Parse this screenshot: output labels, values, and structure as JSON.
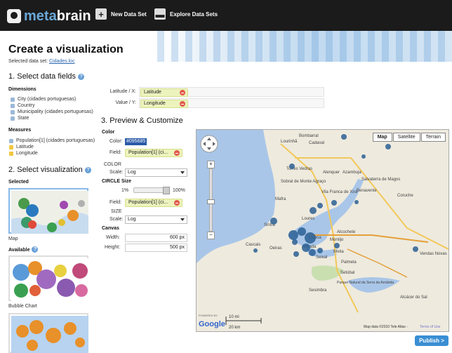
{
  "app": {
    "logo_meta": "meta",
    "logo_brain": "brain",
    "nav": [
      {
        "label": "New Data Set",
        "icon": "plus-icon"
      },
      {
        "label": "Explore Data Sets",
        "icon": "dataset-icon"
      }
    ]
  },
  "page": {
    "title": "Create a visualization",
    "selected_dataset_prefix": "Selected data set:",
    "selected_dataset_link": "Cidades.loc"
  },
  "section1": {
    "title": "1. Select data fields",
    "dimensions_title": "Dimensions",
    "dimensions": [
      "City (cidades portuguesas)",
      "Country",
      "Municipality (cidades portuguesas)",
      "State"
    ],
    "measures_title": "Measures",
    "measures": [
      {
        "label": "Population[1] (cidades portuguesas)",
        "checked": false
      },
      {
        "label": "Latitude",
        "checked": true
      },
      {
        "label": "Longitude",
        "checked": true
      }
    ],
    "x_label": "Latitude / X:",
    "x_value": "Latitude",
    "y_label": "Value / Y:",
    "y_value": "Longitude"
  },
  "section2": {
    "title": "2. Select visualization",
    "selected_title": "Selected",
    "selected_name": "Map",
    "available_title": "Available",
    "available_first": "Bubble Chart"
  },
  "section3": {
    "title": "3. Preview & Customize",
    "color_title": "Color",
    "color_label": "Color:",
    "color_value": "#095685",
    "field_label": "Field:",
    "color_field_value": "Population[1] (ci...",
    "color_scale_group": "COLOR",
    "scale_label": "Scale:",
    "color_scale_value": "Log",
    "circle_title": "CIRCLE Size",
    "slider_min": "1%",
    "slider_max": "100%",
    "size_field_value": "Population[1] (ci...",
    "size_scale_group": "SIZE",
    "size_scale_value": "Log",
    "canvas_title": "Canvas",
    "width_label": "Width:",
    "width_value": "600 px",
    "height_label": "Height:",
    "height_value": "500 px"
  },
  "map": {
    "types": [
      "Map",
      "Satellite",
      "Terrain"
    ],
    "active_type": "Map",
    "cities": [
      "Lourinhã",
      "Bombarral",
      "Cadaval",
      "Torres Vedras",
      "Alenquer",
      "Azambuja",
      "Salvaterra de Magos",
      "Sobral de Monte Agraço",
      "Vila Franca de Xira",
      "Benavente",
      "Mafra",
      "Coruche",
      "Sintra",
      "Loures",
      "Cascais",
      "Oeiras",
      "Lisboa",
      "Alcochete",
      "Almada",
      "Montijo",
      "Moita",
      "Seixal",
      "Palmela",
      "Setúbal",
      "Vendas Novas",
      "Sesimbra",
      "Alcácer do Sal",
      "Parque Natural da Serra da Arrábida"
    ],
    "scale_top": "10 mi",
    "scale_bottom": "20 km",
    "google": "Google",
    "powered_by": "POWERED BY",
    "attribution": "Map data ©2010 Tele Atlas -",
    "terms": "Terms of Use"
  },
  "actions": {
    "publish": "Publish >"
  },
  "colors": {
    "accent": "#3a8ed3",
    "marker": "#2a5f94",
    "header": "#1b1b1b"
  }
}
